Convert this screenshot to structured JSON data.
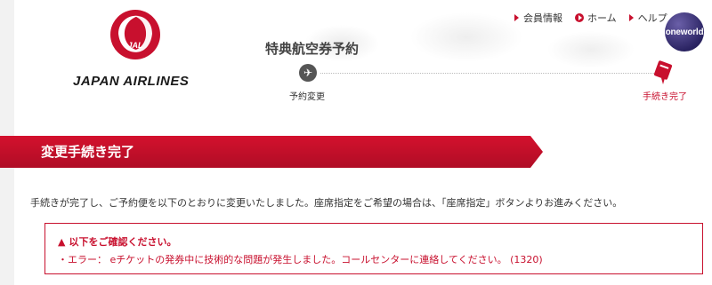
{
  "header": {
    "brand_name": "JAPAN AIRLINES",
    "logo_mark_text": "JAL",
    "nav": [
      {
        "label": "会員情報"
      },
      {
        "label": "ホーム"
      },
      {
        "label": "ヘルプ"
      }
    ],
    "alliance": "oneworld"
  },
  "page_title": "特典航空券予約",
  "progress": {
    "steps": [
      {
        "label": "予約変更",
        "icon": "airplane-icon"
      },
      {
        "label": "手続き完了",
        "icon": "ticket-icon",
        "active": true
      }
    ]
  },
  "banner": {
    "title": "変更手続き完了"
  },
  "intro_text": "手続きが完了し、ご予約便を以下のとおりに変更いたしました。座席指定をご希望の場合は、「座席指定」ボタンよりお進みください。",
  "notice": {
    "heading": "以下をご確認ください。",
    "message": "・エラー： eチケットの発券中に技術的な問題が発生しました。コールセンターに連絡してください。 (1320)"
  },
  "colors": {
    "brand_red": "#c8102e",
    "oneworld_purple": "#2b2463"
  }
}
